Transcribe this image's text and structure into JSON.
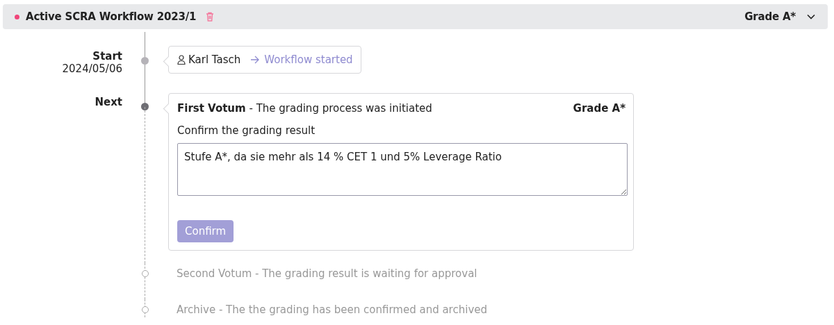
{
  "header": {
    "active": true,
    "title": "Active SCRA Workflow 2023/1",
    "grade": "Grade A*",
    "expanded": true
  },
  "steps": [
    {
      "kind": "done",
      "label": "Start",
      "date": "2024/05/06",
      "user": "Karl Tasch",
      "action": "Workflow started"
    },
    {
      "kind": "current",
      "label": "Next",
      "title": "**First Votum** - The grading process was initiated",
      "grade": "Grade A*",
      "prompt": "Confirm the grading result",
      "value": "Stufe A*, da sie mehr als 14 % CET 1 und 5% Leverage Ratio",
      "button": {
        "label": "Confirm",
        "disabled": true
      }
    },
    {
      "kind": "pending",
      "text": "Second Votum - The grading result is waiting for approval"
    },
    {
      "kind": "pending",
      "text": "Archive - The the grading has been confirmed and archived"
    }
  ]
}
